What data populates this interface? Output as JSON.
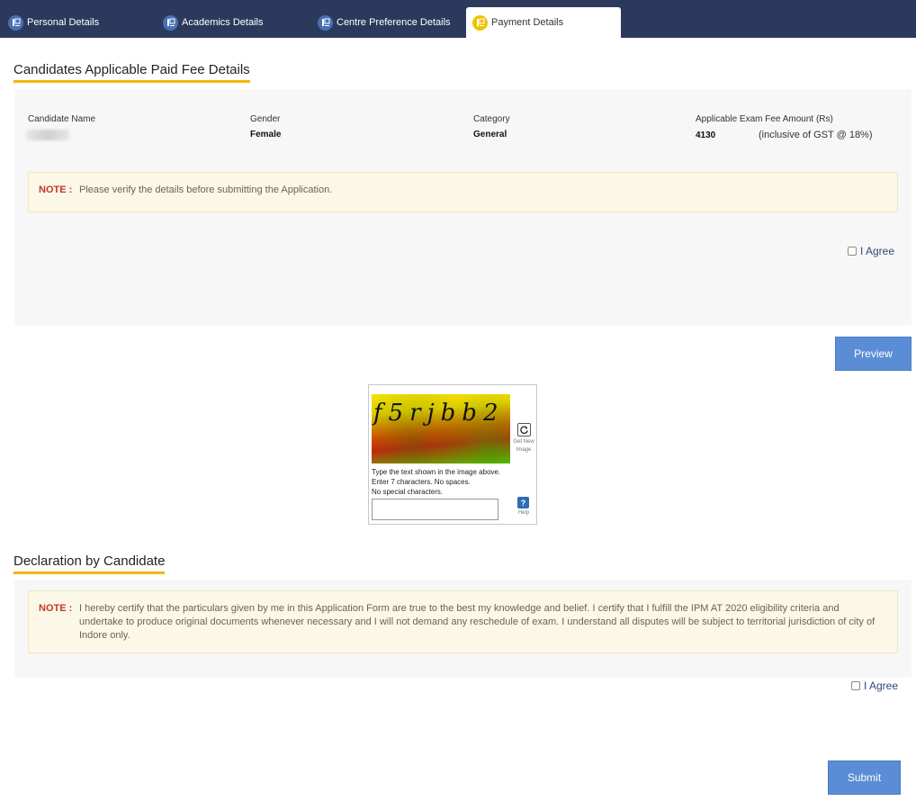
{
  "tabs": [
    {
      "label": "Personal Details",
      "active": false
    },
    {
      "label": "Academics Details",
      "active": false
    },
    {
      "label": "Centre Preference Details",
      "active": false
    },
    {
      "label": "Payment Details",
      "active": true
    }
  ],
  "fee_section": {
    "title": "Candidates Applicable Paid Fee Details",
    "candidate_name_label": "Candidate Name",
    "gender_label": "Gender",
    "gender_value": "Female",
    "category_label": "Category",
    "category_value": "General",
    "fee_label": "Applicable Exam Fee Amount (Rs)",
    "fee_value": "4130",
    "fee_note": "(inclusive of GST @ 18%)",
    "note_label": "NOTE :",
    "note_text": "Please verify the details before submitting the Application.",
    "agree_label": "I Agree"
  },
  "preview_button": "Preview",
  "captcha": {
    "text": "f5rjbb2",
    "refresh_label": "Get New Image",
    "instruction_1": "Type the text shown in the image above.",
    "instruction_2": "Enter 7 characters. No spaces.",
    "instruction_3": "No special characters.",
    "input_value": "",
    "help_label": "Help"
  },
  "declaration": {
    "title": "Declaration by Candidate",
    "note_label": "NOTE :",
    "note_text": "I hereby certify that the particulars given by me in this Application Form are true to the best my knowledge and belief. I certify that I fulfill the IPM AT 2020 eligibility criteria and undertake to produce original documents whenever necessary and I will not demand any reschedule of exam. I understand all disputes will be subject to territorial jurisdiction of city of Indore only.",
    "agree_label": "I Agree"
  },
  "submit_button": "Submit",
  "colors": {
    "tab_bar": "#2b3a5c",
    "accent_underline": "#f0b800",
    "button": "#5b8dd6",
    "note_label": "#c0392b",
    "note_bg": "#fcf8e8"
  }
}
